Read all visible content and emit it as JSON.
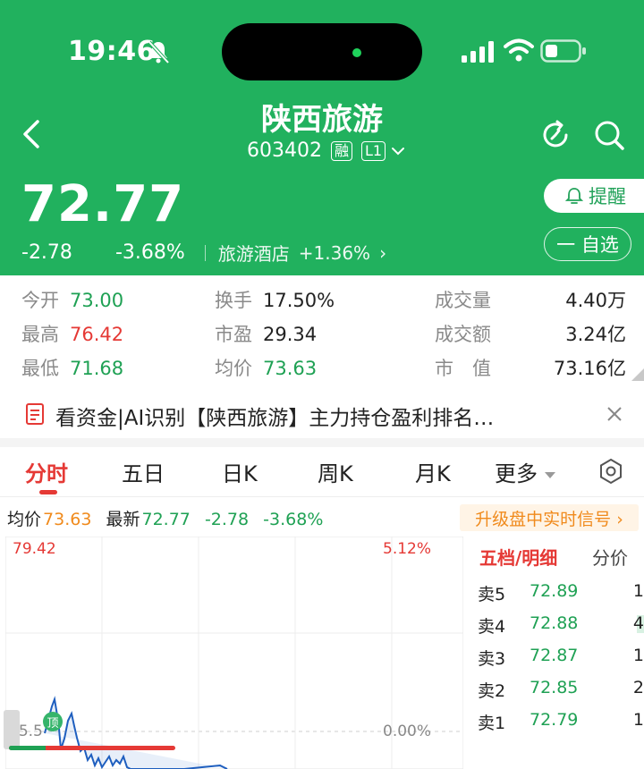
{
  "status_bar": {
    "time": "19:46"
  },
  "header": {
    "stock_name": "陕西旅游",
    "stock_code": "603402",
    "tag_margin": "融",
    "tag_level": "L1",
    "price": "72.77",
    "change": "-2.78",
    "change_pct": "-3.68%",
    "sector_name": "旅游酒店",
    "sector_pct": "+1.36%",
    "sector_arrow": "›",
    "remind_label": "提醒",
    "watch_label": "一 自选"
  },
  "stats": {
    "open": {
      "label": "今开",
      "value": "73.00"
    },
    "high": {
      "label": "最高",
      "value": "76.42"
    },
    "low": {
      "label": "最低",
      "value": "71.68"
    },
    "turnover": {
      "label": "换手",
      "value": "17.50%"
    },
    "pe": {
      "label": "市盈",
      "value": "29.34"
    },
    "avg": {
      "label": "均价",
      "value": "73.63"
    },
    "volume": {
      "label": "成交量",
      "value": "4.40万"
    },
    "amount": {
      "label": "成交额",
      "value": "3.24亿"
    },
    "mcap": {
      "label": "市　值",
      "value": "73.16亿"
    }
  },
  "news": {
    "text": "看资金|AI识别【陕西旅游】主力持仓盈利排名…"
  },
  "tabs": [
    {
      "label": "分时"
    },
    {
      "label": "五日"
    },
    {
      "label": "日K"
    },
    {
      "label": "周K"
    },
    {
      "label": "月K"
    },
    {
      "label": "更多"
    }
  ],
  "quote_line": {
    "avg_label": "均价",
    "avg_value": "73.63",
    "last_label": "最新",
    "last_value": "72.77",
    "change": "-2.78",
    "change_pct": "-3.68%",
    "upgrade_label": "升级盘中实时信号 ›"
  },
  "chart": {
    "top_price": "79.42",
    "top_pct": "5.12%",
    "mid_price": "75.5",
    "mid_pct": "0.00%",
    "peak_badge": "顶"
  },
  "order_book": {
    "tab_active": "五档/明细",
    "tab_other": "分价",
    "rows": [
      {
        "label": "卖5",
        "price": "72.89",
        "volume": "1"
      },
      {
        "label": "卖4",
        "price": "72.88",
        "volume": "4"
      },
      {
        "label": "卖3",
        "price": "72.87",
        "volume": "1"
      },
      {
        "label": "卖2",
        "price": "72.85",
        "volume": "2"
      },
      {
        "label": "卖1",
        "price": "72.79",
        "volume": "1"
      }
    ],
    "buy_ratio": 0.22
  },
  "colors": {
    "header_green": "#21b15e",
    "up_red": "#e53935",
    "down_green": "#1fa154",
    "upgrade_orange": "#f08a1c"
  }
}
